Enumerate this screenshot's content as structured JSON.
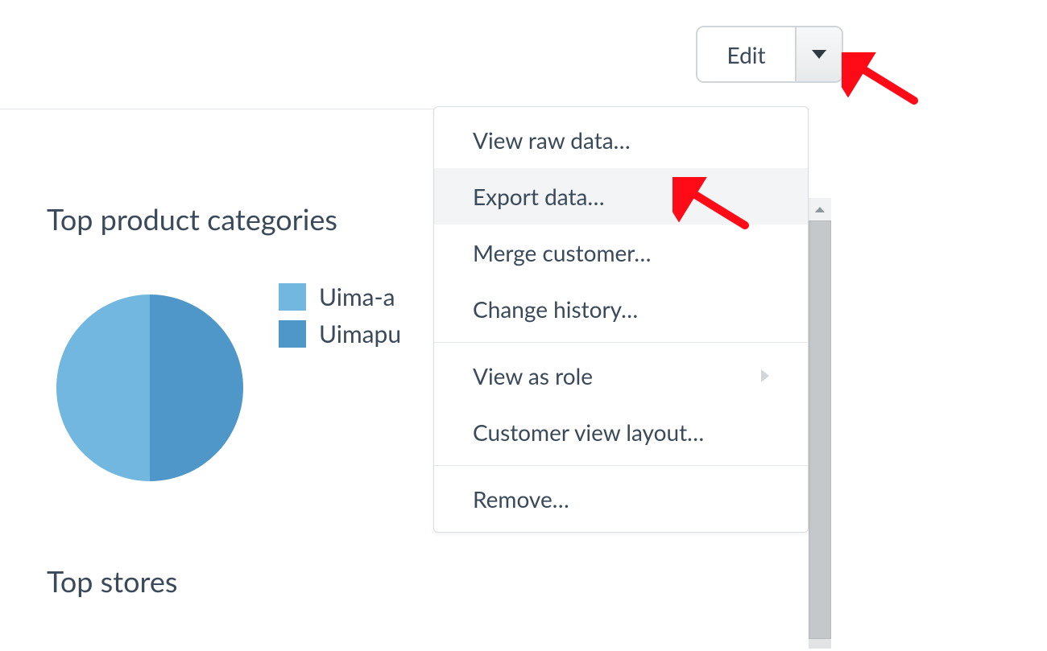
{
  "header": {
    "edit_label": "Edit"
  },
  "sections": {
    "top_categories_title": "Top product categories",
    "top_stores_title": "Top stores"
  },
  "legend": {
    "items": [
      {
        "label": "Uima-a",
        "color": "#72b7df"
      },
      {
        "label": "Uimapu",
        "color": "#4e97c8"
      }
    ]
  },
  "dropdown": {
    "items": [
      {
        "label": "View raw data…",
        "highlight": false,
        "submenu": false
      },
      {
        "label": "Export data…",
        "highlight": true,
        "submenu": false
      },
      {
        "label": "Merge customer…",
        "highlight": false,
        "submenu": false
      },
      {
        "label": "Change history…",
        "highlight": false,
        "submenu": false
      },
      {
        "sep": true
      },
      {
        "label": "View as role",
        "highlight": false,
        "submenu": true
      },
      {
        "label": "Customer view layout…",
        "highlight": false,
        "submenu": false
      },
      {
        "sep": true
      },
      {
        "label": "Remove…",
        "highlight": false,
        "submenu": false
      }
    ]
  },
  "chart_data": {
    "type": "pie",
    "title": "Top product categories",
    "series": [
      {
        "name": "Uima-a",
        "value": 50,
        "color": "#72b7df"
      },
      {
        "name": "Uimapu",
        "value": 50,
        "color": "#4e97c8"
      }
    ]
  },
  "colors": {
    "slice_a": "#72b7df",
    "slice_b": "#4e97c8",
    "arrow": "#ff0a17"
  }
}
